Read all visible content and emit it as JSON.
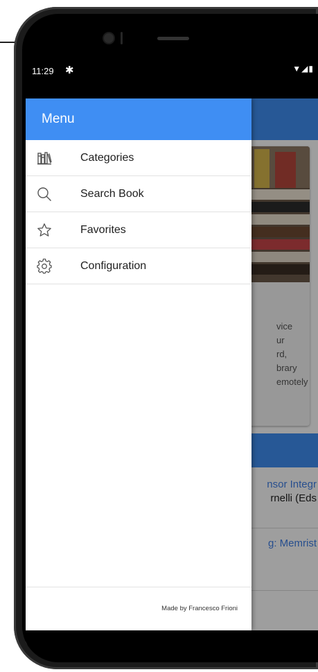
{
  "status_bar": {
    "time": "11:29",
    "settings_icon": "gear-icon",
    "wifi_icon": "wifi-icon",
    "signal_icon": "signal-icon",
    "battery_icon": "battery-icon",
    "indicators": "▼◢▮"
  },
  "drawer": {
    "title": "Menu",
    "items": [
      {
        "label": "Categories",
        "icon": "bookshelf-icon"
      },
      {
        "label": "Search Book",
        "icon": "search-icon"
      },
      {
        "label": "Favorites",
        "icon": "star-icon"
      },
      {
        "label": "Configuration",
        "icon": "gear-icon"
      }
    ],
    "footer": "Made by Francesco Frioni"
  },
  "background": {
    "description_lines": [
      "vice",
      "ur",
      "rd,",
      "brary",
      "emotely"
    ],
    "item1_title": "nsor Integr",
    "item1_subtitle": "rnelli (Eds",
    "item2_title": "g: Memrist"
  },
  "nav_bar": {
    "back_icon": "back-triangle-icon",
    "home_icon": "home-circle-icon",
    "recents_icon": "recents-square-icon"
  },
  "colors": {
    "accent": "#3f8ef3",
    "link": "#3f7fe6",
    "scrim": "rgba(0,0,0,0.38)"
  }
}
